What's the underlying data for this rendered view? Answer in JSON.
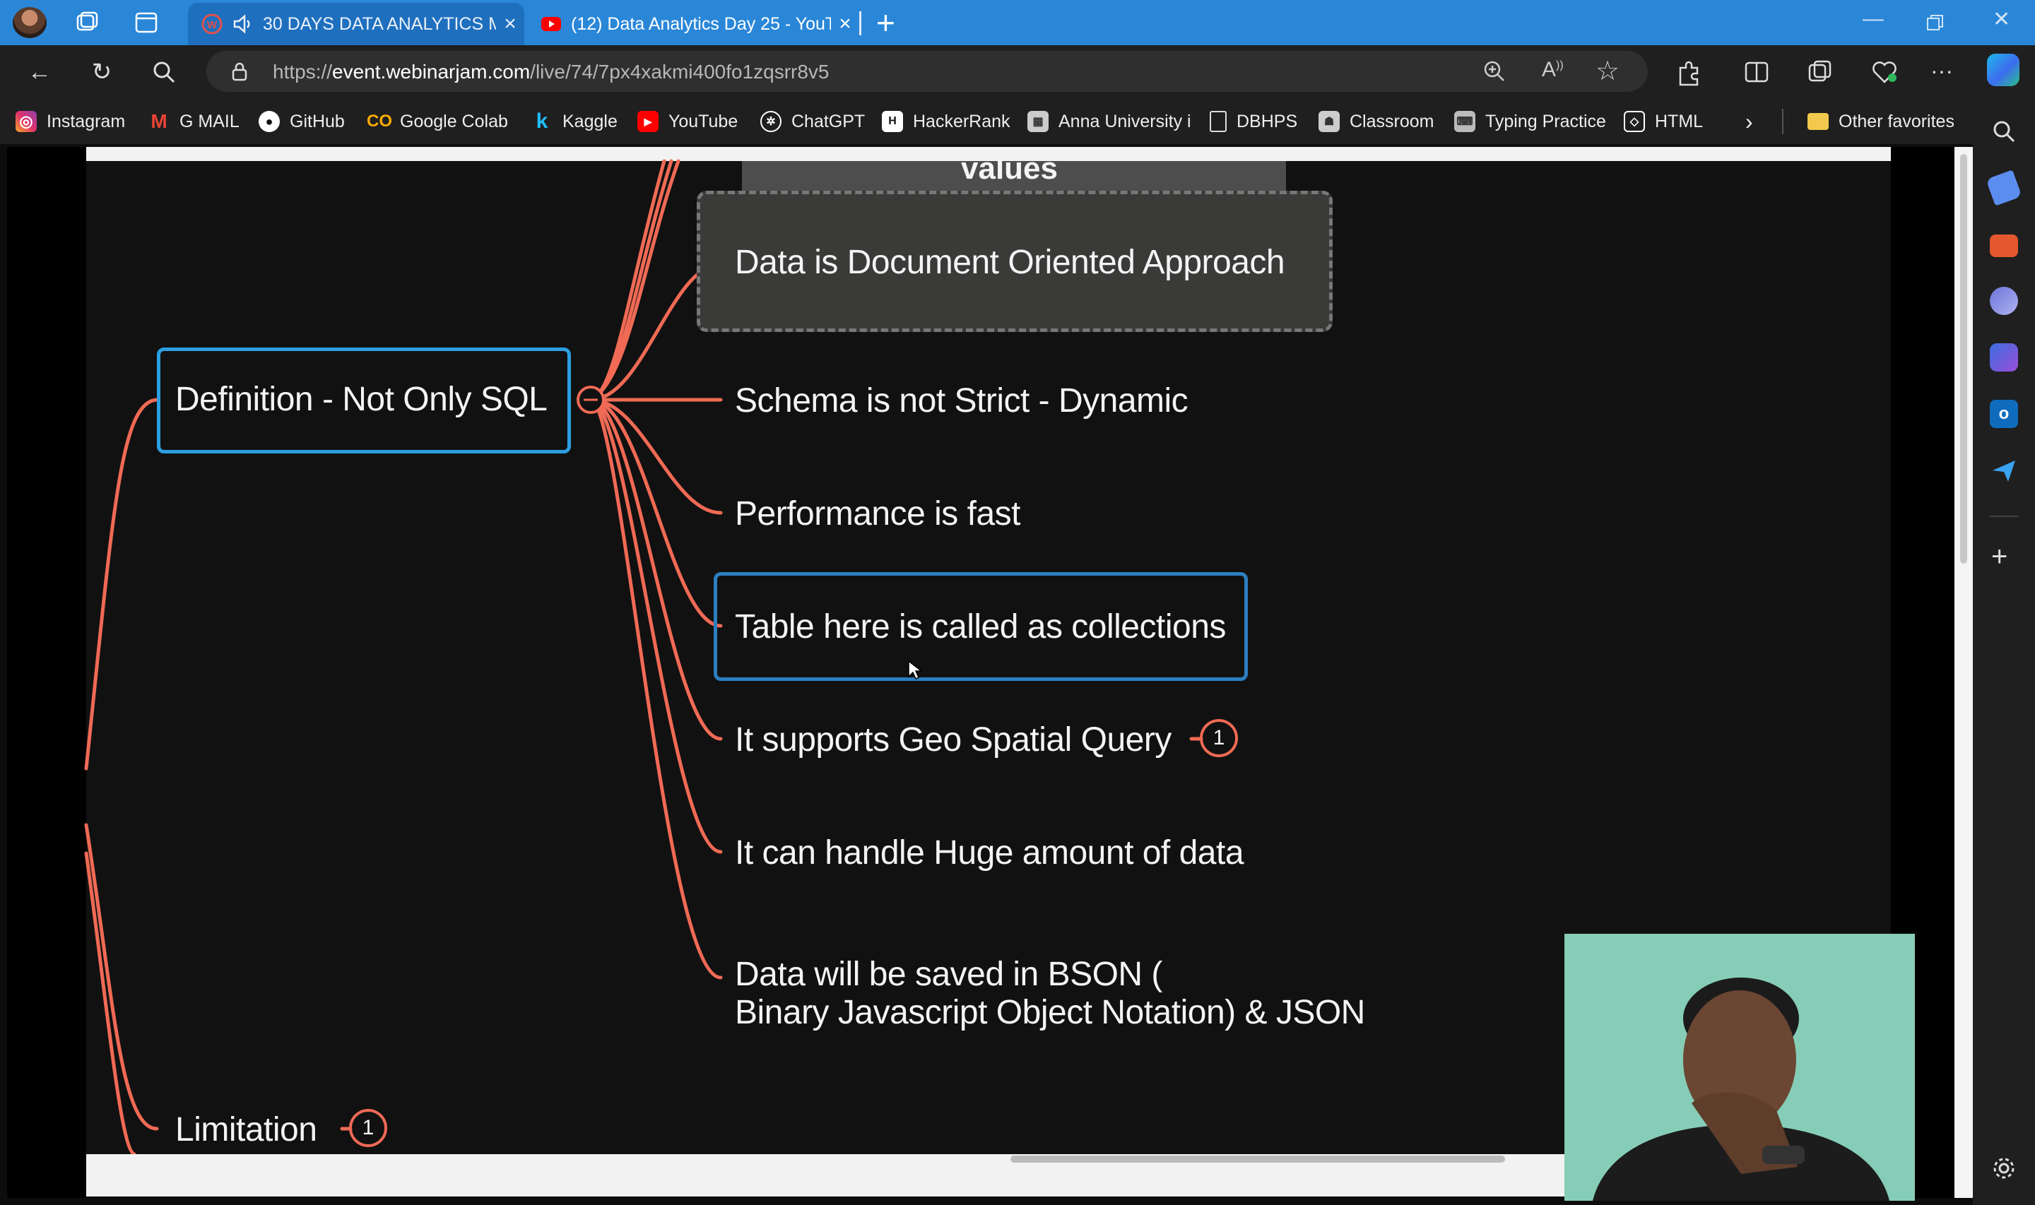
{
  "browser": {
    "tabs": [
      {
        "title": "30 DAYS DATA ANALYTICS M",
        "favicon": "webinar-icon",
        "active": true,
        "audio": true
      },
      {
        "title": "(12) Data Analytics Day 25 - YouT",
        "favicon": "youtube-icon",
        "active": false
      }
    ],
    "url_prefix": "https://",
    "url_domain": "event.webinarjam.com",
    "url_path": "/live/74/7px4xakmi400fo1zqsrr8v5",
    "bookmarks": [
      {
        "label": "Instagram",
        "icon": "instagram-icon",
        "color": "#e1306c"
      },
      {
        "label": "G MAIL",
        "icon": "gmail-icon",
        "color": "#ea4335"
      },
      {
        "label": "GitHub",
        "icon": "github-icon",
        "color": "#ffffff"
      },
      {
        "label": "Google Colab",
        "icon": "colab-icon",
        "color": "#f9ab00"
      },
      {
        "label": "Kaggle",
        "icon": "kaggle-icon",
        "color": "#20beff"
      },
      {
        "label": "YouTube",
        "icon": "youtube-icon",
        "color": "#ff0000"
      },
      {
        "label": "ChatGPT",
        "icon": "chatgpt-icon",
        "color": "#ffffff"
      },
      {
        "label": "HackerRank",
        "icon": "hackerrank-icon",
        "color": "#1ba94c"
      },
      {
        "label": "Anna University i",
        "icon": "university-icon",
        "color": "#cccccc"
      },
      {
        "label": "DBHPS",
        "icon": "document-icon",
        "color": "#dddddd"
      },
      {
        "label": "Classroom",
        "icon": "classroom-icon",
        "color": "#cccccc"
      },
      {
        "label": "Typing Practice",
        "icon": "keyboard-icon",
        "color": "#cccccc"
      },
      {
        "label": "HTML",
        "icon": "codepen-icon",
        "color": "#ffffff"
      }
    ],
    "other_favorites": "Other favorites"
  },
  "mindmap": {
    "partial_title": "values",
    "root": "Definition - Not Only SQL",
    "children": [
      {
        "label": "Data is Document Oriented Approach",
        "style": "dashed-box"
      },
      {
        "label": "Schema is not Strict - Dynamic",
        "style": "plain"
      },
      {
        "label": "Performance is fast",
        "style": "plain"
      },
      {
        "label": "Table here is called as collections",
        "style": "blue-box"
      },
      {
        "label": "It supports Geo Spatial Query",
        "style": "plain",
        "badge": "1"
      },
      {
        "label": "It can handle Huge amount of data",
        "style": "plain"
      },
      {
        "label_line1": "Data will be saved in BSON (",
        "label_line2": "Binary Javascript Object Notation) & JSON",
        "style": "plain"
      }
    ],
    "sibling": {
      "label": "Limitation",
      "badge": "1"
    },
    "colors": {
      "branch": "#f06a55",
      "root_border": "#2b9fe0",
      "background": "#111111"
    }
  }
}
